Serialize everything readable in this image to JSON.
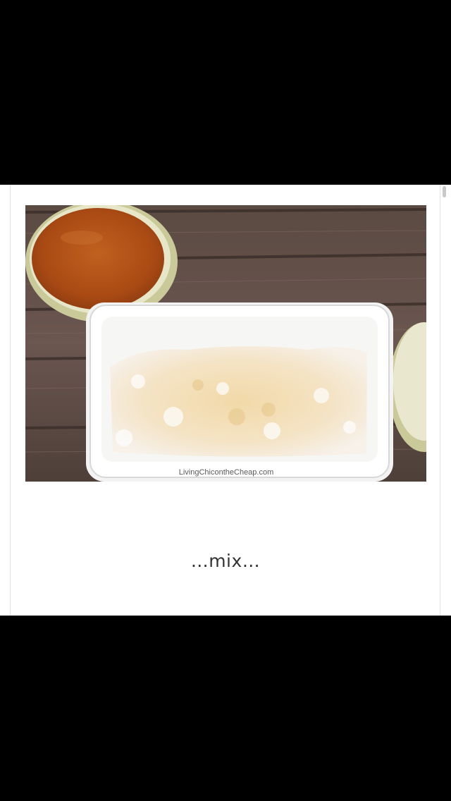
{
  "image": {
    "watermark": "LivingChicontheCheap.com"
  },
  "caption": "…mix…"
}
